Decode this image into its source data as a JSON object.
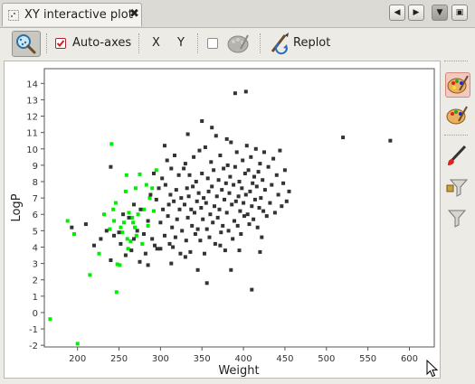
{
  "tab": {
    "title": "XY interactive plot",
    "close": "✖"
  },
  "nav": {
    "left": "◀",
    "right": "▶",
    "menu": "▼",
    "maximize": "▣"
  },
  "toolbar": {
    "auto_axes_label": "Auto-axes",
    "auto_axes_checked": true,
    "x_label": "X",
    "y_label": "Y",
    "extra_checked": false,
    "replot_label": "Replot"
  },
  "colors": {
    "dark_points": "#333333",
    "green_points": "#00ee00",
    "checkbox_checked": "#cc2222"
  },
  "chart_data": {
    "type": "scatter",
    "xlabel": "Weight",
    "ylabel": "LogP",
    "xlim": [
      160,
      630
    ],
    "ylim": [
      -2.1,
      14.9
    ],
    "x_ticks": [
      200,
      250,
      300,
      350,
      400,
      450,
      500,
      550,
      600
    ],
    "y_ticks": [
      -2,
      -1,
      0,
      1,
      2,
      3,
      4,
      5,
      6,
      7,
      8,
      9,
      10,
      11,
      12,
      13,
      14
    ],
    "series": [
      {
        "color": "#00ee00",
        "points": [
          [
            167,
            -0.4
          ],
          [
            200,
            -1.9
          ],
          [
            188,
            5.6
          ],
          [
            196,
            4.8
          ],
          [
            215,
            2.3
          ],
          [
            226,
            3.6
          ],
          [
            232,
            6.0
          ],
          [
            239,
            5.1
          ],
          [
            241,
            10.3
          ],
          [
            243,
            6.3
          ],
          [
            244,
            5.6
          ],
          [
            246,
            6.7
          ],
          [
            247,
            1.25
          ],
          [
            248,
            2.95
          ],
          [
            251,
            2.9
          ],
          [
            252,
            5.2
          ],
          [
            254,
            4.9
          ],
          [
            256,
            5.5
          ],
          [
            258,
            7.4
          ],
          [
            259,
            8.4
          ],
          [
            260,
            4.5
          ],
          [
            261,
            3.9
          ],
          [
            262,
            6.1
          ],
          [
            264,
            4.35
          ],
          [
            266,
            5.8
          ],
          [
            267,
            5.5
          ],
          [
            269,
            5.2
          ],
          [
            270,
            7.6
          ],
          [
            271,
            4.7
          ],
          [
            273,
            6.0
          ],
          [
            275,
            8.45
          ],
          [
            278,
            4.2
          ],
          [
            280,
            6.3
          ],
          [
            283,
            7.8
          ],
          [
            285,
            5.3
          ],
          [
            287,
            7.0
          ],
          [
            290,
            7.6
          ],
          [
            292,
            6.2
          ],
          [
            295,
            8.7
          ]
        ]
      },
      {
        "color": "#333333",
        "points": [
          [
            193,
            5.2
          ],
          [
            210,
            5.4
          ],
          [
            220,
            4.1
          ],
          [
            228,
            4.5
          ],
          [
            235,
            5.0
          ],
          [
            240,
            3.2
          ],
          [
            244,
            4.7
          ],
          [
            252,
            4.2
          ],
          [
            255,
            6.0
          ],
          [
            258,
            3.5
          ],
          [
            262,
            5.8
          ],
          [
            265,
            3.8
          ],
          [
            268,
            6.6
          ],
          [
            272,
            5.0
          ],
          [
            276,
            6.3
          ],
          [
            280,
            4.8
          ],
          [
            282,
            3.6
          ],
          [
            285,
            5.6
          ],
          [
            288,
            7.2
          ],
          [
            290,
            4.5
          ],
          [
            292,
            8.5
          ],
          [
            293,
            4.1
          ],
          [
            295,
            6.9
          ],
          [
            296,
            3.9
          ],
          [
            298,
            7.6
          ],
          [
            300,
            5.5
          ],
          [
            302,
            8.2
          ],
          [
            303,
            6.3
          ],
          [
            305,
            4.7
          ],
          [
            306,
            7.8
          ],
          [
            308,
            9.3
          ],
          [
            309,
            5.9
          ],
          [
            310,
            6.6
          ],
          [
            311,
            4.2
          ],
          [
            312,
            7.2
          ],
          [
            313,
            8.8
          ],
          [
            314,
            5.2
          ],
          [
            316,
            6.8
          ],
          [
            317,
            9.6
          ],
          [
            318,
            4.6
          ],
          [
            319,
            7.5
          ],
          [
            320,
            5.7
          ],
          [
            322,
            8.4
          ],
          [
            323,
            6.3
          ],
          [
            324,
            3.6
          ],
          [
            325,
            7.0
          ],
          [
            326,
            5.0
          ],
          [
            328,
            8.8
          ],
          [
            329,
            6.6
          ],
          [
            330,
            9.1
          ],
          [
            331,
            4.4
          ],
          [
            332,
            7.6
          ],
          [
            333,
            5.8
          ],
          [
            334,
            7.1
          ],
          [
            335,
            8.4
          ],
          [
            336,
            3.7
          ],
          [
            337,
            6.3
          ],
          [
            338,
            5.3
          ],
          [
            339,
            7.7
          ],
          [
            340,
            9.5
          ],
          [
            341,
            6.1
          ],
          [
            342,
            4.8
          ],
          [
            343,
            8.0
          ],
          [
            344,
            6.8
          ],
          [
            345,
            5.1
          ],
          [
            346,
            7.3
          ],
          [
            347,
            9.9
          ],
          [
            348,
            4.4
          ],
          [
            349,
            6.4
          ],
          [
            350,
            8.5
          ],
          [
            351,
            5.7
          ],
          [
            352,
            7.0
          ],
          [
            353,
            3.6
          ],
          [
            354,
            10.1
          ],
          [
            355,
            6.7
          ],
          [
            356,
            5.1
          ],
          [
            357,
            8.2
          ],
          [
            358,
            7.4
          ],
          [
            359,
            4.6
          ],
          [
            360,
            6.0
          ],
          [
            361,
            9.2
          ],
          [
            362,
            7.7
          ],
          [
            363,
            5.5
          ],
          [
            364,
            8.7
          ],
          [
            365,
            6.5
          ],
          [
            366,
            4.2
          ],
          [
            367,
            10.8
          ],
          [
            368,
            7.1
          ],
          [
            369,
            5.8
          ],
          [
            370,
            8.1
          ],
          [
            371,
            6.3
          ],
          [
            372,
            9.6
          ],
          [
            373,
            4.9
          ],
          [
            374,
            7.5
          ],
          [
            375,
            5.3
          ],
          [
            376,
            8.8
          ],
          [
            377,
            6.9
          ],
          [
            378,
            3.8
          ],
          [
            379,
            7.9
          ],
          [
            380,
            6.1
          ],
          [
            381,
            9.0
          ],
          [
            382,
            5.0
          ],
          [
            383,
            7.3
          ],
          [
            384,
            8.3
          ],
          [
            385,
            10.4
          ],
          [
            386,
            6.6
          ],
          [
            387,
            4.5
          ],
          [
            388,
            7.8
          ],
          [
            389,
            5.6
          ],
          [
            390,
            8.9
          ],
          [
            391,
            6.8
          ],
          [
            392,
            9.8
          ],
          [
            393,
            5.3
          ],
          [
            394,
            7.1
          ],
          [
            395,
            8.0
          ],
          [
            396,
            6.2
          ],
          [
            397,
            4.8
          ],
          [
            398,
            7.6
          ],
          [
            399,
            9.3
          ],
          [
            400,
            6.7
          ],
          [
            401,
            5.9
          ],
          [
            402,
            8.5
          ],
          [
            403,
            7.2
          ],
          [
            404,
            10.2
          ],
          [
            405,
            6.0
          ],
          [
            406,
            8.7
          ],
          [
            407,
            5.4
          ],
          [
            408,
            7.4
          ],
          [
            409,
            9.5
          ],
          [
            410,
            6.5
          ],
          [
            411,
            7.9
          ],
          [
            412,
            5.7
          ],
          [
            413,
            8.3
          ],
          [
            414,
            6.9
          ],
          [
            415,
            10.0
          ],
          [
            416,
            7.7
          ],
          [
            417,
            5.2
          ],
          [
            418,
            8.6
          ],
          [
            419,
            6.4
          ],
          [
            420,
            9.1
          ],
          [
            421,
            7.0
          ],
          [
            422,
            4.6
          ],
          [
            423,
            8.1
          ],
          [
            424,
            6.2
          ],
          [
            425,
            9.8
          ],
          [
            426,
            7.5
          ],
          [
            428,
            5.9
          ],
          [
            430,
            8.9
          ],
          [
            432,
            6.7
          ],
          [
            434,
            7.8
          ],
          [
            436,
            9.4
          ],
          [
            438,
            6.1
          ],
          [
            440,
            8.4
          ],
          [
            442,
            7.2
          ],
          [
            444,
            9.9
          ],
          [
            446,
            6.5
          ],
          [
            448,
            7.9
          ],
          [
            450,
            8.7
          ],
          [
            452,
            6.8
          ],
          [
            455,
            7.4
          ],
          [
            300,
            3.9
          ],
          [
            315,
            4.0
          ],
          [
            330,
            3.4
          ],
          [
            345,
            2.6
          ],
          [
            356,
            1.8
          ],
          [
            372,
            4.1
          ],
          [
            385,
            2.6
          ],
          [
            395,
            3.8
          ],
          [
            410,
            1.4
          ],
          [
            420,
            3.7
          ],
          [
            240,
            8.9
          ],
          [
            250,
            4.9
          ],
          [
            275,
            3.1
          ],
          [
            285,
            2.9
          ],
          [
            268,
            4.5
          ],
          [
            313,
            3.0
          ],
          [
            305,
            10.2
          ],
          [
            333,
            10.9
          ],
          [
            390,
            13.4
          ],
          [
            403,
            13.5
          ],
          [
            350,
            11.7
          ],
          [
            362,
            11.3
          ],
          [
            380,
            10.6
          ],
          [
            520,
            10.7
          ],
          [
            577,
            10.5
          ]
        ]
      }
    ]
  }
}
